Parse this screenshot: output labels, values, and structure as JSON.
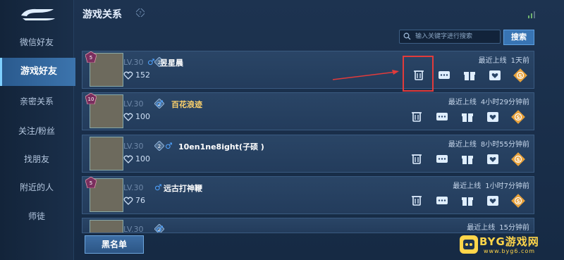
{
  "header": {
    "title": "游戏关系"
  },
  "sidebar": {
    "items": [
      {
        "label": "微信好友"
      },
      {
        "label": "游戏好友"
      },
      {
        "label": "亲密关系"
      },
      {
        "label": "关注/粉丝"
      },
      {
        "label": "找朋友"
      },
      {
        "label": "附近的人"
      },
      {
        "label": "师徒"
      }
    ]
  },
  "search": {
    "placeholder": "输入关键字进行搜索",
    "button_label": "搜索"
  },
  "friends": [
    {
      "level": "LV.30",
      "hearts": "152",
      "name": "昱星晨",
      "last_online_label": "最近上线",
      "last_online": "1天前",
      "rank": "5"
    },
    {
      "level": "LV.30",
      "hearts": "100",
      "name": "百花浪迹",
      "last_online_label": "最近上线",
      "last_online": "4小时29分钟前",
      "rank": "10"
    },
    {
      "level": "LV.30",
      "hearts": "100",
      "name": "10en1ne8ight(子硕 )",
      "last_online_label": "最近上线",
      "last_online": "8小时55分钟前",
      "rank": ""
    },
    {
      "level": "LV.30",
      "hearts": "76",
      "name": "远古打神鞭",
      "last_online_label": "最近上线",
      "last_online": "1小时7分钟前",
      "rank": "5"
    },
    {
      "level": "LV.30",
      "hearts": "",
      "name": "",
      "last_online_label": "最近上线",
      "last_online": "15分钟前",
      "rank": ""
    }
  ],
  "footer": {
    "blacklist_label": "黑名单"
  },
  "watermark": {
    "text": "BYG游戏网",
    "url": "www.byg6.com"
  },
  "colors": {
    "accent": "#3874b3",
    "highlight": "#e23b3b",
    "name_gold": "#ffd36b",
    "gender_male": "#4fa3ff"
  },
  "icons": [
    "back-icon",
    "help-icon",
    "signal-icon",
    "search-icon",
    "delete-icon",
    "chat-icon",
    "gift-icon",
    "heart-icon",
    "coin-icon"
  ]
}
